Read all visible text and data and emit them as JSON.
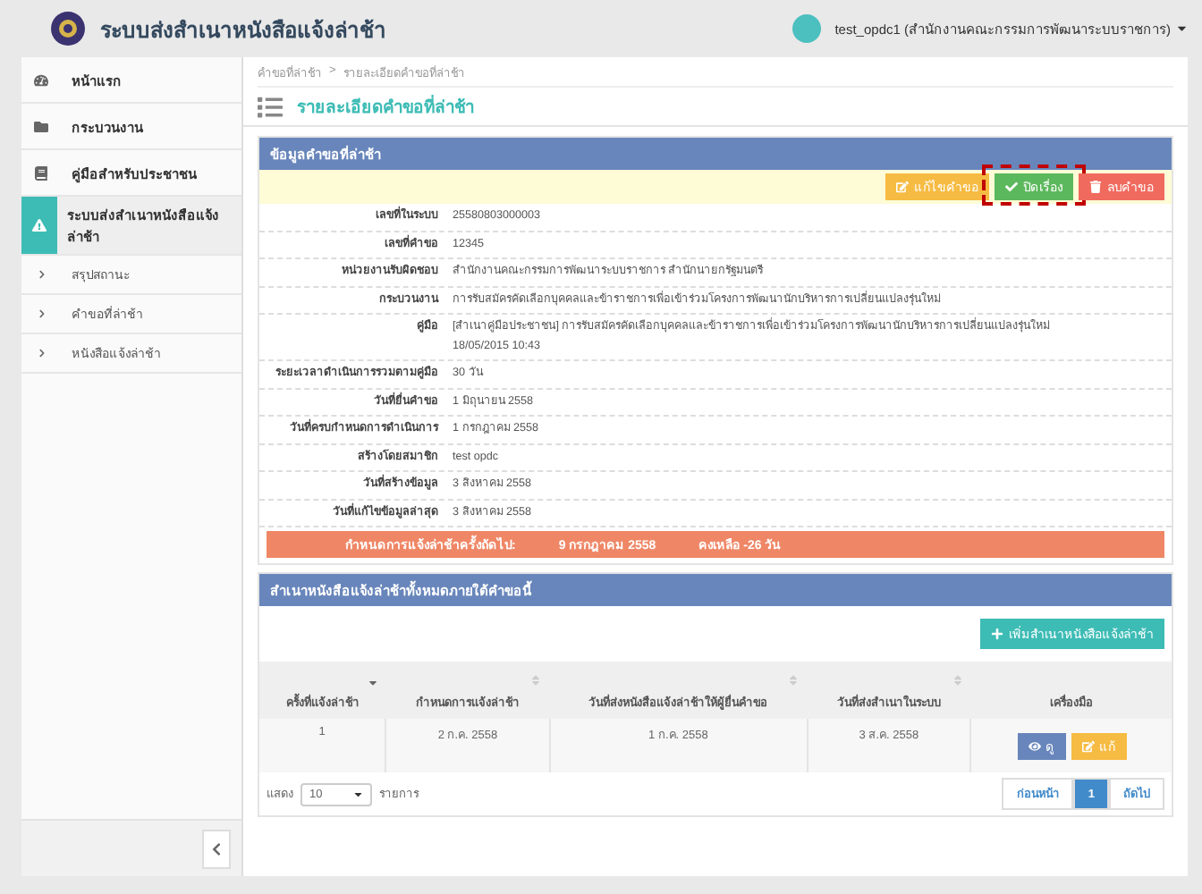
{
  "header": {
    "title": "ระบบส่งสำเนาหนังสือแจ้งล่าช้า",
    "user": "test_opdc1 (สำนักงานคณะกรรมการพัฒนาระบบราชการ)"
  },
  "sidebar": {
    "items": [
      {
        "label": "หน้าแรก",
        "selected": false
      },
      {
        "label": "กระบวนงาน",
        "selected": false
      },
      {
        "label": "คู่มือสำหรับประชาชน",
        "selected": false
      },
      {
        "label": "ระบบส่งสำเนาหนังสือแจ้งล่าช้า",
        "selected": true,
        "children": [
          {
            "label": "สรุปสถานะ"
          },
          {
            "label": "คำขอที่ล่าช้า"
          },
          {
            "label": "หนังสือแจ้งล่าช้า"
          }
        ]
      }
    ]
  },
  "breadcrumb": {
    "items": [
      "คำขอที่ล่าช้า",
      "รายละเอียดคำขอที่ล่าช้า"
    ],
    "separator": ">"
  },
  "page_title": "รายละเอียดคำขอที่ล่าช้า",
  "detail_panel": {
    "title": "ข้อมูลคำขอที่ล่าช้า",
    "actions": [
      {
        "kind": "edit",
        "label": "แก้ไขคำขอ",
        "highlighted": false
      },
      {
        "kind": "close",
        "label": "ปิดเรื่อง",
        "highlighted": true
      },
      {
        "kind": "delete",
        "label": "ลบคำขอ",
        "highlighted": false
      }
    ],
    "fields": [
      {
        "label": "เลขที่ในระบบ",
        "value": [
          "25580803000003"
        ]
      },
      {
        "label": "เลขที่คำขอ",
        "value": [
          "12345"
        ]
      },
      {
        "label": "หน่วยงานรับผิดชอบ",
        "value": [
          "สำนักงานคณะกรรมการพัฒนาระบบราชการ สำนักนายกรัฐมนตรี"
        ]
      },
      {
        "label": "กระบวนงาน",
        "value": [
          "การรับสมัครคัดเลือกบุคคลและข้าราชการเพื่อเข้าร่วมโครงการพัฒนานักบริหารการเปลี่ยนแปลงรุ่นใหม่"
        ]
      },
      {
        "label": "คู่มือ",
        "value": [
          "[สำเนาคู่มือประชาชน] การรับสมัครคัดเลือกบุคคลและข้าราชการเพื่อเข้าร่วมโครงการพัฒนานักบริหารการเปลี่ยนแปลงรุ่นใหม่",
          "18/05/2015 10:43"
        ]
      },
      {
        "label": "ระยะเวลาดำเนินการรวมตามคู่มือ",
        "value": [
          "30 วัน"
        ]
      },
      {
        "label": "วันที่ยื่นคำขอ",
        "value": [
          "1 มิถุนายน 2558"
        ]
      },
      {
        "label": "วันที่ครบกำหนดการดำเนินการ",
        "value": [
          "1 กรกฎาคม 2558"
        ]
      },
      {
        "label": "สร้างโดยสมาชิก",
        "value": [
          "test opdc"
        ]
      },
      {
        "label": "วันที่สร้างข้อมูล",
        "value": [
          "3 สิงหาคม 2558"
        ]
      },
      {
        "label": "วันที่แก้ไขข้อมูลล่าสุด",
        "value": [
          "3 สิงหาคม 2558"
        ]
      }
    ],
    "deadline": {
      "label": "กำหนดการแจ้งล่าช้าครั้งถัดไป:",
      "date": "9 กรกฎาคม 2558",
      "remaining": "คงเหลือ -26 วัน"
    }
  },
  "notices_panel": {
    "title": "สำเนาหนังสือแจ้งล่าช้าทั้งหมดภายใต้คำขอนี้",
    "add_button": "เพิ่มสำเนาหนังสือแจ้งล่าช้า",
    "columns": [
      {
        "label": "ครั้งที่แจ้งล่าช้า",
        "sortable": true,
        "sorted": true
      },
      {
        "label": "กำหนดการแจ้งล่าช้า",
        "sortable": true,
        "sorted": false
      },
      {
        "label": "วันที่ส่งหนังสือแจ้งล่าช้าให้ผู้ยื่นคำขอ",
        "sortable": true,
        "sorted": false
      },
      {
        "label": "วันที่ส่งสำเนาในระบบ",
        "sortable": true,
        "sorted": false
      },
      {
        "label": "เครื่องมือ",
        "sortable": false
      }
    ],
    "rows": [
      {
        "cells": [
          "1",
          "2 ก.ค. 2558",
          "1 ก.ค. 2558",
          "3 ส.ค. 2558"
        ],
        "tools": [
          {
            "kind": "view",
            "label": "ดู"
          },
          {
            "kind": "edit",
            "label": "แก้"
          }
        ]
      }
    ],
    "length": {
      "before": "แสดง",
      "value": "10",
      "after": "รายการ"
    },
    "pagination": [
      {
        "label": "ก่อนหน้า",
        "selected": false
      },
      {
        "label": "1",
        "selected": true
      },
      {
        "label": "ถัดไป",
        "selected": false
      }
    ]
  }
}
